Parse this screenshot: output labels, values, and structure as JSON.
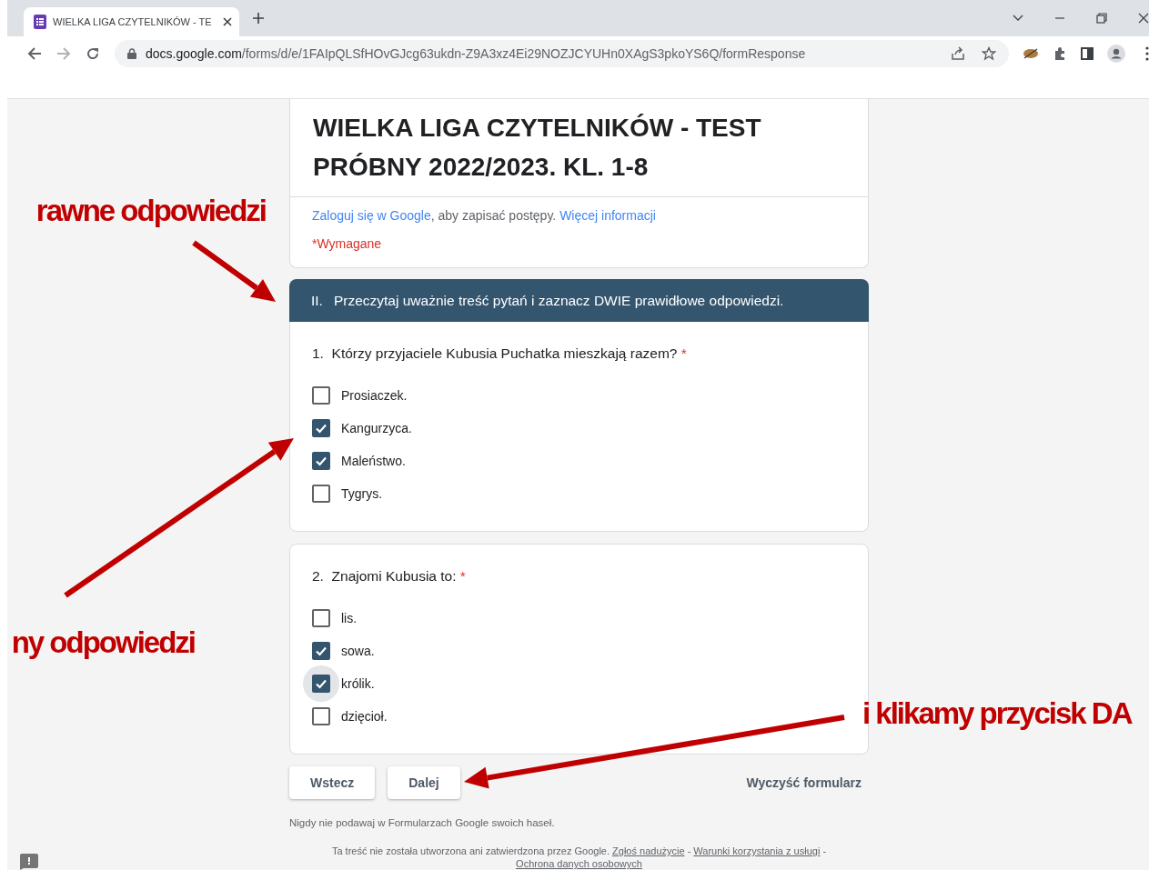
{
  "browser": {
    "tab": {
      "title": "WIELKA LIGA CZYTELNIKÓW - TE",
      "selected": true
    },
    "address": {
      "host": "docs.google.com",
      "path": "/forms/d/e/1FAIpQLSfHOvGJcg63ukdn-Z9A3xz4Ei29NOZJCYUHn0XAgS3pkoYS6Q/formResponse"
    }
  },
  "form": {
    "title": "WIELKA LIGA CZYTELNIKÓW - TEST PRÓBNY 2022/2023. KL. 1-8",
    "signin": {
      "link": "Zaloguj się w Google",
      "text": ", aby zapisać postępy.",
      "more": "Więcej informacji"
    },
    "required_note": "*Wymagane",
    "section": {
      "number": "II.",
      "title": "Przeczytaj uważnie treść pytań i zaznacz DWIE prawidłowe odpowiedzi."
    },
    "questions": [
      {
        "number": "1.",
        "text": "Którzy przyjaciele Kubusia Puchatka mieszkają razem?",
        "required_mark": "*",
        "options": [
          {
            "label": "Prosiaczek.",
            "checked": false,
            "focused": false
          },
          {
            "label": "Kangurzyca.",
            "checked": true,
            "focused": false
          },
          {
            "label": "Maleństwo.",
            "checked": true,
            "focused": false
          },
          {
            "label": "Tygrys.",
            "checked": false,
            "focused": false
          }
        ]
      },
      {
        "number": "2.",
        "text": "Znajomi Kubusia to:",
        "required_mark": "*",
        "options": [
          {
            "label": "lis.",
            "checked": false,
            "focused": false
          },
          {
            "label": "sowa.",
            "checked": true,
            "focused": false
          },
          {
            "label": "królik.",
            "checked": true,
            "focused": true
          },
          {
            "label": "dzięcioł.",
            "checked": false,
            "focused": false
          }
        ]
      }
    ],
    "buttons": [
      {
        "label": "Wstecz"
      },
      {
        "label": "Dalej"
      }
    ],
    "clear": "Wyczyść formularz",
    "footer": {
      "warning": "Nigdy nie podawaj w Formularzach Google swoich haseł.",
      "notice": "Ta treść nie została utworzona ani zatwierdzona przez Google.",
      "links": [
        "Zgłoś nadużycie",
        "Warunki korzystania z usługi",
        "Ochrona danych osobowych"
      ],
      "separator": "-"
    }
  },
  "annotations": [
    {
      "text": "rawne odpowiedzi"
    },
    {
      "text": "ny odpowiedzi"
    },
    {
      "text": "i klikamy przycisk DA"
    }
  ]
}
